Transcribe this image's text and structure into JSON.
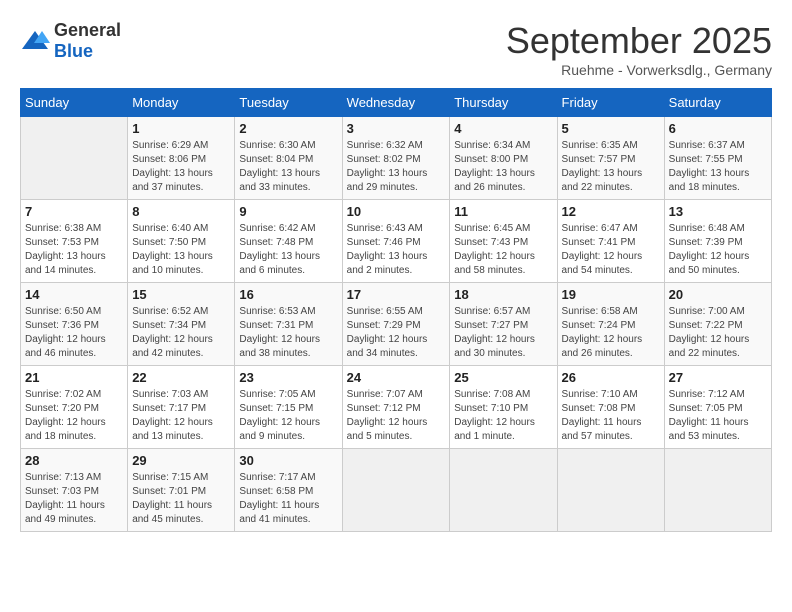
{
  "logo": {
    "general": "General",
    "blue": "Blue"
  },
  "title": "September 2025",
  "subtitle": "Ruehme - Vorwerksdlg., Germany",
  "days_of_week": [
    "Sunday",
    "Monday",
    "Tuesday",
    "Wednesday",
    "Thursday",
    "Friday",
    "Saturday"
  ],
  "weeks": [
    [
      {
        "day": "",
        "info": ""
      },
      {
        "day": "1",
        "info": "Sunrise: 6:29 AM\nSunset: 8:06 PM\nDaylight: 13 hours\nand 37 minutes."
      },
      {
        "day": "2",
        "info": "Sunrise: 6:30 AM\nSunset: 8:04 PM\nDaylight: 13 hours\nand 33 minutes."
      },
      {
        "day": "3",
        "info": "Sunrise: 6:32 AM\nSunset: 8:02 PM\nDaylight: 13 hours\nand 29 minutes."
      },
      {
        "day": "4",
        "info": "Sunrise: 6:34 AM\nSunset: 8:00 PM\nDaylight: 13 hours\nand 26 minutes."
      },
      {
        "day": "5",
        "info": "Sunrise: 6:35 AM\nSunset: 7:57 PM\nDaylight: 13 hours\nand 22 minutes."
      },
      {
        "day": "6",
        "info": "Sunrise: 6:37 AM\nSunset: 7:55 PM\nDaylight: 13 hours\nand 18 minutes."
      }
    ],
    [
      {
        "day": "7",
        "info": "Sunrise: 6:38 AM\nSunset: 7:53 PM\nDaylight: 13 hours\nand 14 minutes."
      },
      {
        "day": "8",
        "info": "Sunrise: 6:40 AM\nSunset: 7:50 PM\nDaylight: 13 hours\nand 10 minutes."
      },
      {
        "day": "9",
        "info": "Sunrise: 6:42 AM\nSunset: 7:48 PM\nDaylight: 13 hours\nand 6 minutes."
      },
      {
        "day": "10",
        "info": "Sunrise: 6:43 AM\nSunset: 7:46 PM\nDaylight: 13 hours\nand 2 minutes."
      },
      {
        "day": "11",
        "info": "Sunrise: 6:45 AM\nSunset: 7:43 PM\nDaylight: 12 hours\nand 58 minutes."
      },
      {
        "day": "12",
        "info": "Sunrise: 6:47 AM\nSunset: 7:41 PM\nDaylight: 12 hours\nand 54 minutes."
      },
      {
        "day": "13",
        "info": "Sunrise: 6:48 AM\nSunset: 7:39 PM\nDaylight: 12 hours\nand 50 minutes."
      }
    ],
    [
      {
        "day": "14",
        "info": "Sunrise: 6:50 AM\nSunset: 7:36 PM\nDaylight: 12 hours\nand 46 minutes."
      },
      {
        "day": "15",
        "info": "Sunrise: 6:52 AM\nSunset: 7:34 PM\nDaylight: 12 hours\nand 42 minutes."
      },
      {
        "day": "16",
        "info": "Sunrise: 6:53 AM\nSunset: 7:31 PM\nDaylight: 12 hours\nand 38 minutes."
      },
      {
        "day": "17",
        "info": "Sunrise: 6:55 AM\nSunset: 7:29 PM\nDaylight: 12 hours\nand 34 minutes."
      },
      {
        "day": "18",
        "info": "Sunrise: 6:57 AM\nSunset: 7:27 PM\nDaylight: 12 hours\nand 30 minutes."
      },
      {
        "day": "19",
        "info": "Sunrise: 6:58 AM\nSunset: 7:24 PM\nDaylight: 12 hours\nand 26 minutes."
      },
      {
        "day": "20",
        "info": "Sunrise: 7:00 AM\nSunset: 7:22 PM\nDaylight: 12 hours\nand 22 minutes."
      }
    ],
    [
      {
        "day": "21",
        "info": "Sunrise: 7:02 AM\nSunset: 7:20 PM\nDaylight: 12 hours\nand 18 minutes."
      },
      {
        "day": "22",
        "info": "Sunrise: 7:03 AM\nSunset: 7:17 PM\nDaylight: 12 hours\nand 13 minutes."
      },
      {
        "day": "23",
        "info": "Sunrise: 7:05 AM\nSunset: 7:15 PM\nDaylight: 12 hours\nand 9 minutes."
      },
      {
        "day": "24",
        "info": "Sunrise: 7:07 AM\nSunset: 7:12 PM\nDaylight: 12 hours\nand 5 minutes."
      },
      {
        "day": "25",
        "info": "Sunrise: 7:08 AM\nSunset: 7:10 PM\nDaylight: 12 hours\nand 1 minute."
      },
      {
        "day": "26",
        "info": "Sunrise: 7:10 AM\nSunset: 7:08 PM\nDaylight: 11 hours\nand 57 minutes."
      },
      {
        "day": "27",
        "info": "Sunrise: 7:12 AM\nSunset: 7:05 PM\nDaylight: 11 hours\nand 53 minutes."
      }
    ],
    [
      {
        "day": "28",
        "info": "Sunrise: 7:13 AM\nSunset: 7:03 PM\nDaylight: 11 hours\nand 49 minutes."
      },
      {
        "day": "29",
        "info": "Sunrise: 7:15 AM\nSunset: 7:01 PM\nDaylight: 11 hours\nand 45 minutes."
      },
      {
        "day": "30",
        "info": "Sunrise: 7:17 AM\nSunset: 6:58 PM\nDaylight: 11 hours\nand 41 minutes."
      },
      {
        "day": "",
        "info": ""
      },
      {
        "day": "",
        "info": ""
      },
      {
        "day": "",
        "info": ""
      },
      {
        "day": "",
        "info": ""
      }
    ]
  ]
}
